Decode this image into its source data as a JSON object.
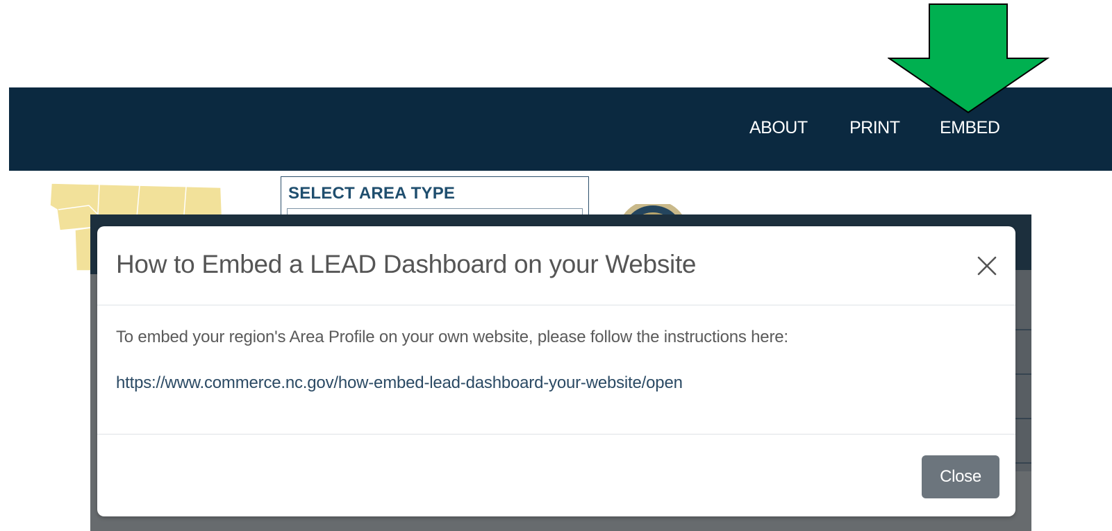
{
  "nav": {
    "links": [
      {
        "label": "ABOUT"
      },
      {
        "label": "PRINT"
      },
      {
        "label": "EMBED"
      }
    ]
  },
  "area_selector": {
    "title": "SELECT AREA TYPE"
  },
  "modal": {
    "title": "How to Embed a LEAD Dashboard on your Website",
    "body_text": "To embed your region's Area Profile on your own website, please follow the instructions here:",
    "link": "https://www.commerce.nc.gov/how-embed-lead-dashboard-your-website/open",
    "close_label": "Close"
  },
  "colors": {
    "navbar": "#0b2940",
    "annotation_arrow": "#00b050",
    "close_button": "#6c757d",
    "map_fill": "#f2e19a"
  },
  "icons": {
    "close": "close-x-icon",
    "annotation": "arrow-down-icon"
  }
}
